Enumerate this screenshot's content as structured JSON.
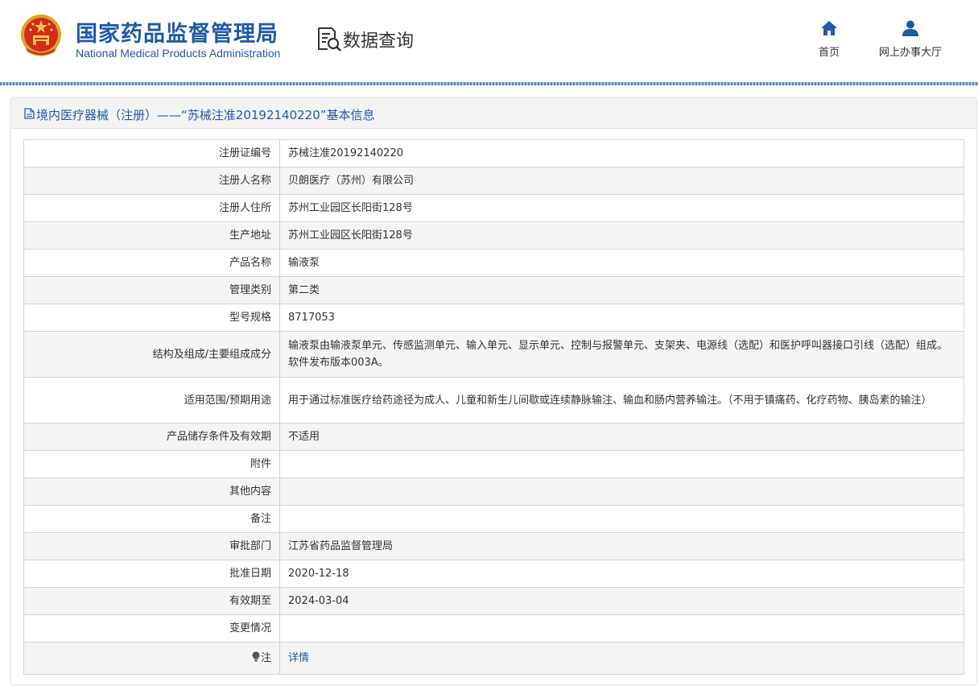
{
  "header": {
    "logo_cn": "国家药品监督管理局",
    "logo_en": "National Medical Products Administration",
    "query_title": "数据查询",
    "nav": [
      {
        "label": "首页",
        "icon": "home-icon"
      },
      {
        "label": "网上办事大厅",
        "icon": "user-icon"
      }
    ],
    "brand_color": "#1f5aa8"
  },
  "panel": {
    "title": "境内医疗器械（注册）——“苏械注准20192140220”基本信息"
  },
  "rows": [
    {
      "label": "注册证编号",
      "value": "苏械注准20192140220"
    },
    {
      "label": "注册人名称",
      "value": "贝朗医疗（苏州）有限公司"
    },
    {
      "label": "注册人住所",
      "value": "苏州工业园区长阳街128号"
    },
    {
      "label": "生产地址",
      "value": "苏州工业园区长阳街128号"
    },
    {
      "label": "产品名称",
      "value": "输液泵"
    },
    {
      "label": "管理类别",
      "value": "第二类"
    },
    {
      "label": "型号规格",
      "value": "8717053"
    },
    {
      "label": "结构及组成/主要组成成分",
      "value": "输液泵由输液泵单元、传感监测单元、输入单元、显示单元、控制与报警单元、支架夹、电源线（选配）和医护呼叫器接口引线（选配）组成。软件发布版本003A。"
    },
    {
      "label": "适用范围/预期用途",
      "value": "用于通过标准医疗给药途径为成人、儿童和新生儿间歇或连续静脉输注、输血和肠内营养输注。（不用于镇痛药、化疗药物、胰岛素的输注）"
    },
    {
      "label": "产品储存条件及有效期",
      "value": "不适用"
    },
    {
      "label": "附件",
      "value": ""
    },
    {
      "label": "其他内容",
      "value": ""
    },
    {
      "label": "备注",
      "value": ""
    },
    {
      "label": "审批部门",
      "value": "江苏省药品监督管理局"
    },
    {
      "label": "批准日期",
      "value": "2020-12-18"
    },
    {
      "label": "有效期至",
      "value": "2024-03-04"
    },
    {
      "label": "变更情况",
      "value": ""
    }
  ],
  "note": {
    "label": "注",
    "link_text": "详情",
    "icon": "lightbulb-icon"
  }
}
